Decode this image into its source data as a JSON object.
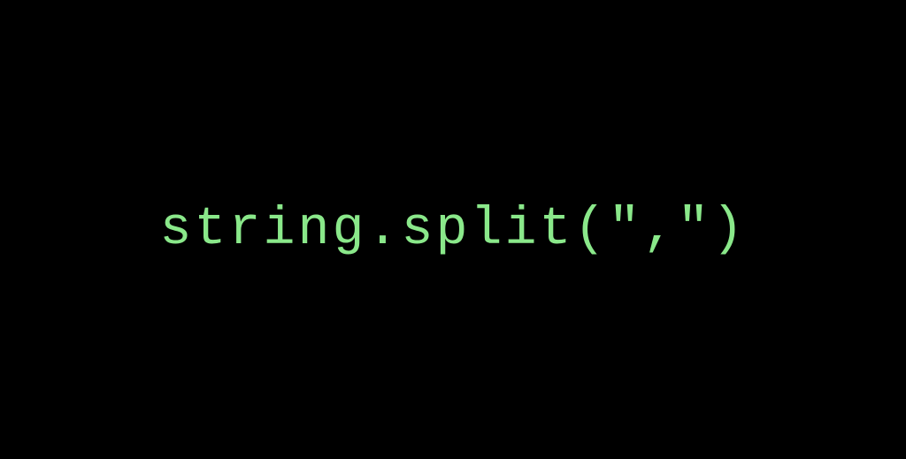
{
  "code": {
    "text": "string.split(\",\")"
  }
}
